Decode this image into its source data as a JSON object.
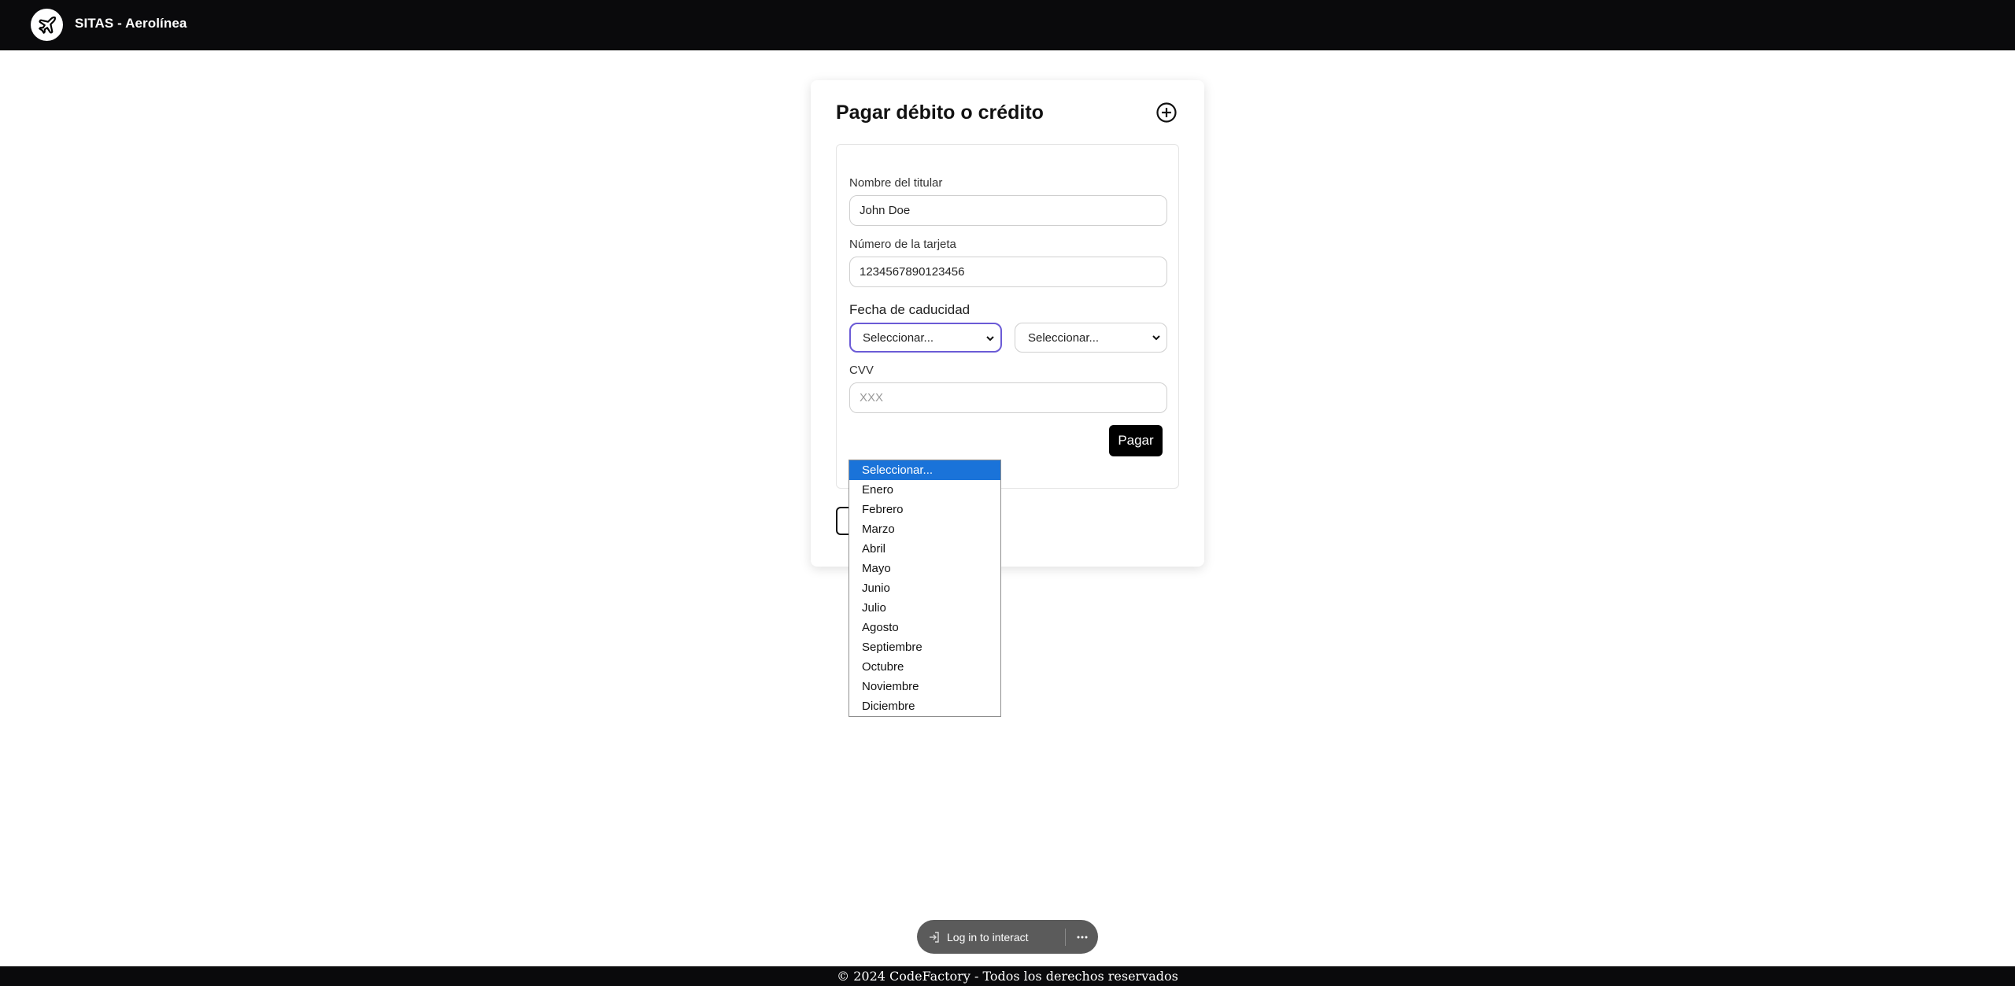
{
  "header": {
    "brand": "SITAS - Aerolínea",
    "logo_icon": "airplane-icon"
  },
  "card": {
    "title": "Pagar débito o crédito",
    "add_icon": "plus-circle-icon",
    "form": {
      "holder_label": "Nombre del titular",
      "holder_value": "John Doe",
      "card_number_label": "Número de la tarjeta",
      "card_number_value": "1234567890123456",
      "expiry_label": "Fecha de caducidad",
      "month_select_value": "Seleccionar...",
      "year_select_value": "Seleccionar...",
      "cvv_label": "CVV",
      "cvv_placeholder": "XXX",
      "pay_label": "Pagar"
    }
  },
  "month_dropdown": {
    "options": [
      "Seleccionar...",
      "Enero",
      "Febrero",
      "Marzo",
      "Abril",
      "Mayo",
      "Junio",
      "Julio",
      "Agosto",
      "Septiembre",
      "Octubre",
      "Noviembre",
      "Diciembre"
    ],
    "highlighted": "Seleccionar..."
  },
  "overlay": {
    "login_label": "Log in to interact",
    "login_icon": "login-icon",
    "more_icon": "more-icon"
  },
  "footer": {
    "text": "© 2024 CodeFactory - Todos los derechos reservados"
  },
  "colors": {
    "header_bg": "#0a0a0c",
    "focus_border": "#6b5bd6",
    "option_highlight": "#1a73d9",
    "button_bg": "#000000"
  }
}
